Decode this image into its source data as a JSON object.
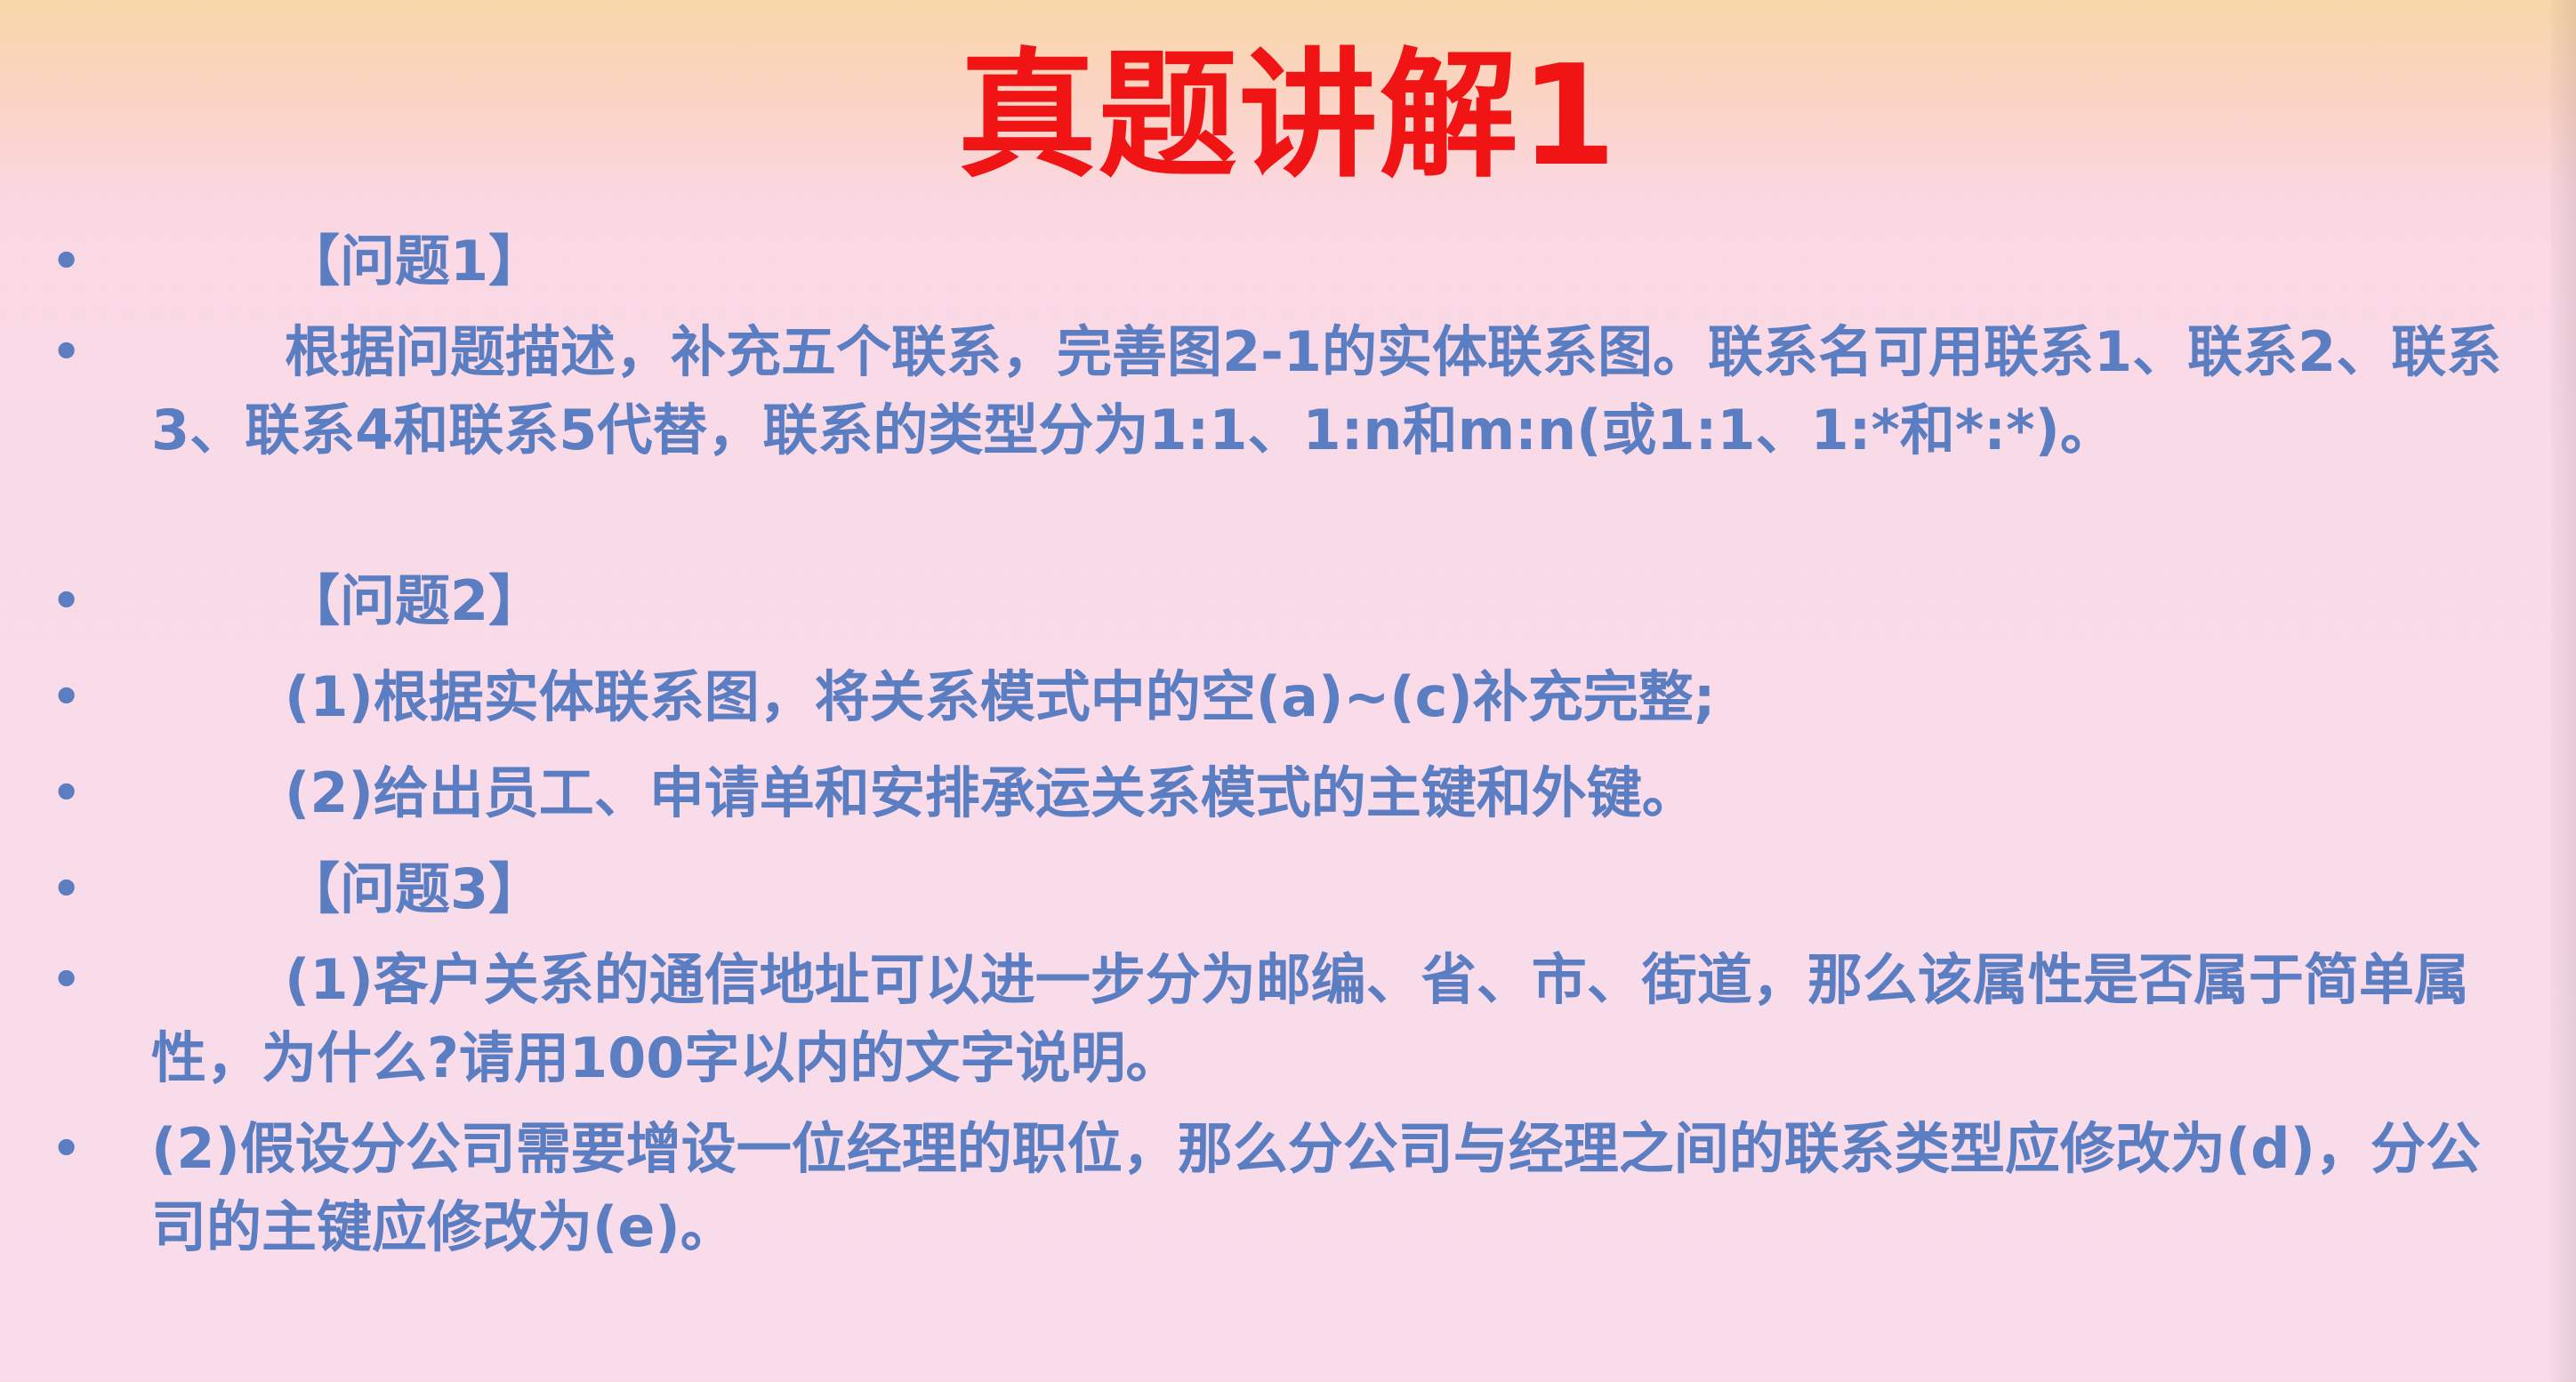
{
  "slide": {
    "title": "真题讲解1",
    "items": [
      {
        "label": "【问题1】"
      },
      {
        "label": "根据问题描述，补充五个联系，完善图2-1的实体联系图。联系名可用联系1、联系2、联系3、联系4和联系5代替，联系的类型分为1:1、1:n和m:n(或1:1、1:*和*:*)。"
      },
      {
        "label": "【问题2】"
      },
      {
        "label": "(1)根据实体联系图，将关系模式中的空(a)~(c)补充完整;"
      },
      {
        "label": "(2)给出员工、申请单和安排承运关系模式的主键和外键。"
      },
      {
        "label": "【问题3】"
      },
      {
        "label": "(1)客户关系的通信地址可以进一步分为邮编、省、市、街道，那么该属性是否属于简单属性，为什么?请用100字以内的文字说明。"
      },
      {
        "label": "(2)假设分公司需要增设一位经理的职位，那么分公司与经理之间的联系类型应修改为(d)，分公司的主键应修改为(e)。"
      }
    ],
    "bullet_symbol": "•"
  }
}
